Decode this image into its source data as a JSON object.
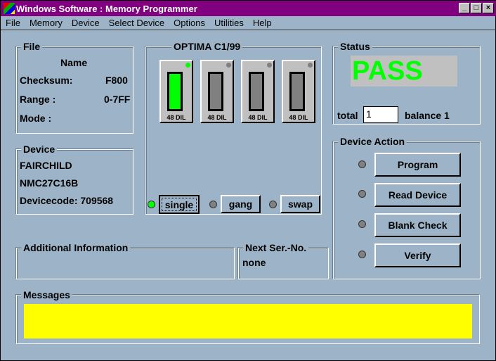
{
  "title": "Windows Software :  Memory Programmer",
  "menu": [
    "File",
    "Memory",
    "Device",
    "Select Device",
    "Options",
    "Utilities",
    "Help"
  ],
  "file": {
    "label": "File",
    "name_label": "Name",
    "checksum_label": "Checksum:",
    "checksum": "F800",
    "range_label": "Range :",
    "range": "0-7FF",
    "mode_label": "Mode :"
  },
  "device": {
    "label": "Device",
    "manufacturer": "FAIRCHILD",
    "part": "NMC27C16B",
    "devicecode": "Devicecode: 709568"
  },
  "programmer": {
    "label": "OPTIMA  C1/99",
    "sockets": [
      {
        "label": "48 DIL",
        "active": true
      },
      {
        "label": "48 DIL",
        "active": false
      },
      {
        "label": "48 DIL",
        "active": false
      },
      {
        "label": "48 DIL",
        "active": false
      }
    ],
    "modes": [
      "single",
      "gang",
      "swap"
    ],
    "selected_mode": "single"
  },
  "status": {
    "label": "Status",
    "result": "PASS",
    "total_label": "total",
    "total": "1",
    "balance": "balance 1"
  },
  "actions": {
    "label": "Device Action",
    "buttons": [
      "Program",
      "Read Device",
      "Blank Check",
      "Verify"
    ]
  },
  "additional": {
    "label": "Additional Information"
  },
  "serial": {
    "label": "Next Ser.-No.",
    "value": "none"
  },
  "messages": {
    "label": "Messages"
  },
  "colors": {
    "pass": "#00ff00",
    "message_bg": "#ffff00",
    "title_bg": "#800080"
  }
}
